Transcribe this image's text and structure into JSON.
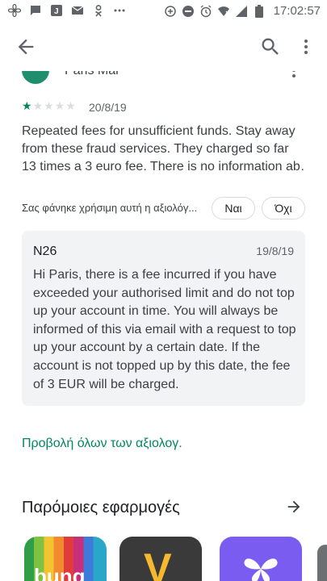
{
  "status_bar": {
    "time": "17:02:57",
    "left_icons": [
      "photo-flower-icon",
      "messages-icon",
      "wallet-j-icon",
      "email-icon",
      "ok-icon",
      "more-dots-icon"
    ],
    "right_icons": [
      "data-saver-icon",
      "dnd-icon",
      "alarm-icon",
      "wifi-icon",
      "signal-icon",
      "battery-icon"
    ]
  },
  "app_bar": {
    "back_icon": "arrow-back-icon",
    "search_icon": "search-icon",
    "more_icon": "more-vert-icon"
  },
  "review": {
    "author": "Paris Mar",
    "rating": 1,
    "max_rating": 5,
    "date": "20/8/19",
    "text_lines": [
      "Repeated fees for unsufficient funds. Stay away",
      "from these fraud services. They charged so far",
      "13 times a 3 euro fee. There is no information ab…"
    ]
  },
  "helpful": {
    "question": "Σας φάνηκε χρήσιμη αυτή η αξιολόγ...",
    "yes_label": "Ναι",
    "no_label": "Όχι"
  },
  "developer_reply": {
    "developer": "N26",
    "date": "19/8/19",
    "text": "Hi Paris, there is a fee incurred if you have exceeded your authorised limit and do not top up your account in time. You will always be informed of this via email with a request to top up your account by a certain date. If the account is not topped up by this date, the fee of 3 EUR will be charged."
  },
  "see_all_label": "Προβολή όλων των αξιολογ.",
  "similar_apps": {
    "title": "Παρόμοιες εφαρμογές",
    "arrow_icon": "arrow-forward-icon",
    "apps": [
      {
        "tile_text": "bunq",
        "color": "#e23b3b"
      },
      {
        "tile_text": "V",
        "color": "#3a3a3a"
      },
      {
        "tile_text": "",
        "color": "#7b5cf0"
      }
    ]
  },
  "colors": {
    "accent": "#01875f",
    "reply_bg": "#f1f3f4"
  }
}
